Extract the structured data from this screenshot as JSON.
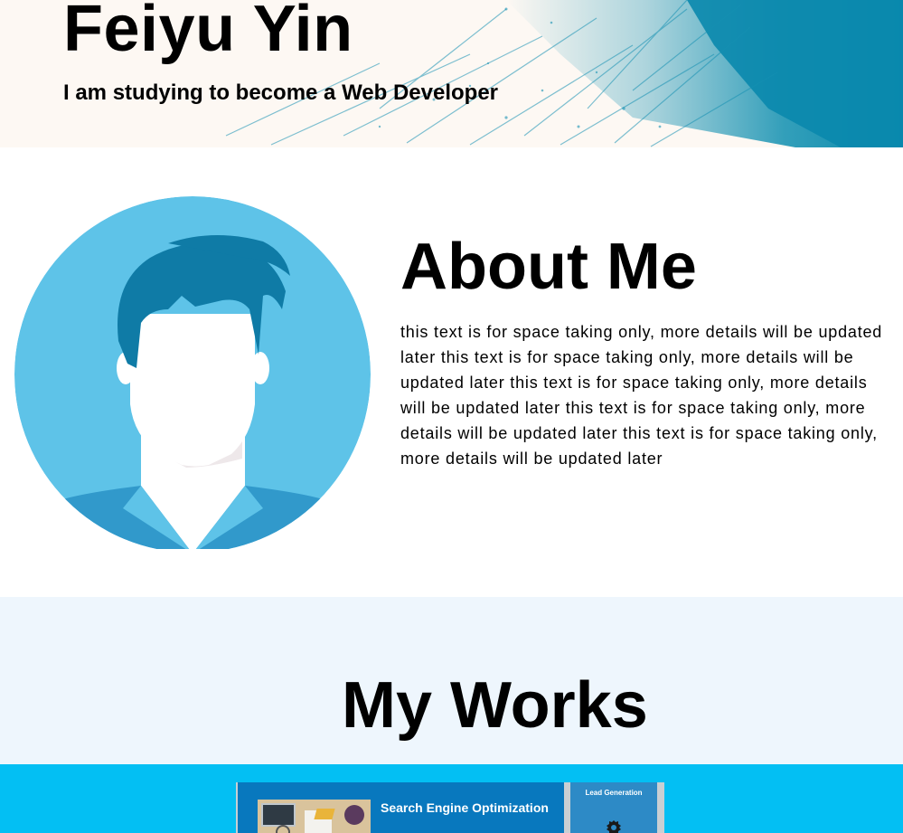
{
  "hero": {
    "name": "Feiyu Yin",
    "tagline": "I am studying to become a Web Developer"
  },
  "about": {
    "title": "About Me",
    "text": "this text is for space taking only, more details will be updated later this text is for space taking only, more details will be updated later this text is for space taking only, more details will be updated later this text is for space taking only, more details will be updated later this text is for space taking only, more details will be updated later"
  },
  "works": {
    "title": "My Works",
    "items": [
      {
        "title": "Search Engine Optimization",
        "side_title": "Lead Generation",
        "side_icon": "gear-icon"
      }
    ]
  },
  "colors": {
    "hero_bg": "#fdf8f3",
    "brush_teal": "#0f8fb0",
    "avatar_circle": "#5ec3e8",
    "avatar_hair": "#0f7ba6",
    "avatar_shirt": "#3199cb",
    "works_bg": "#eef6fd",
    "gallery_bg": "#03bff3",
    "card_blue": "#0878be"
  }
}
